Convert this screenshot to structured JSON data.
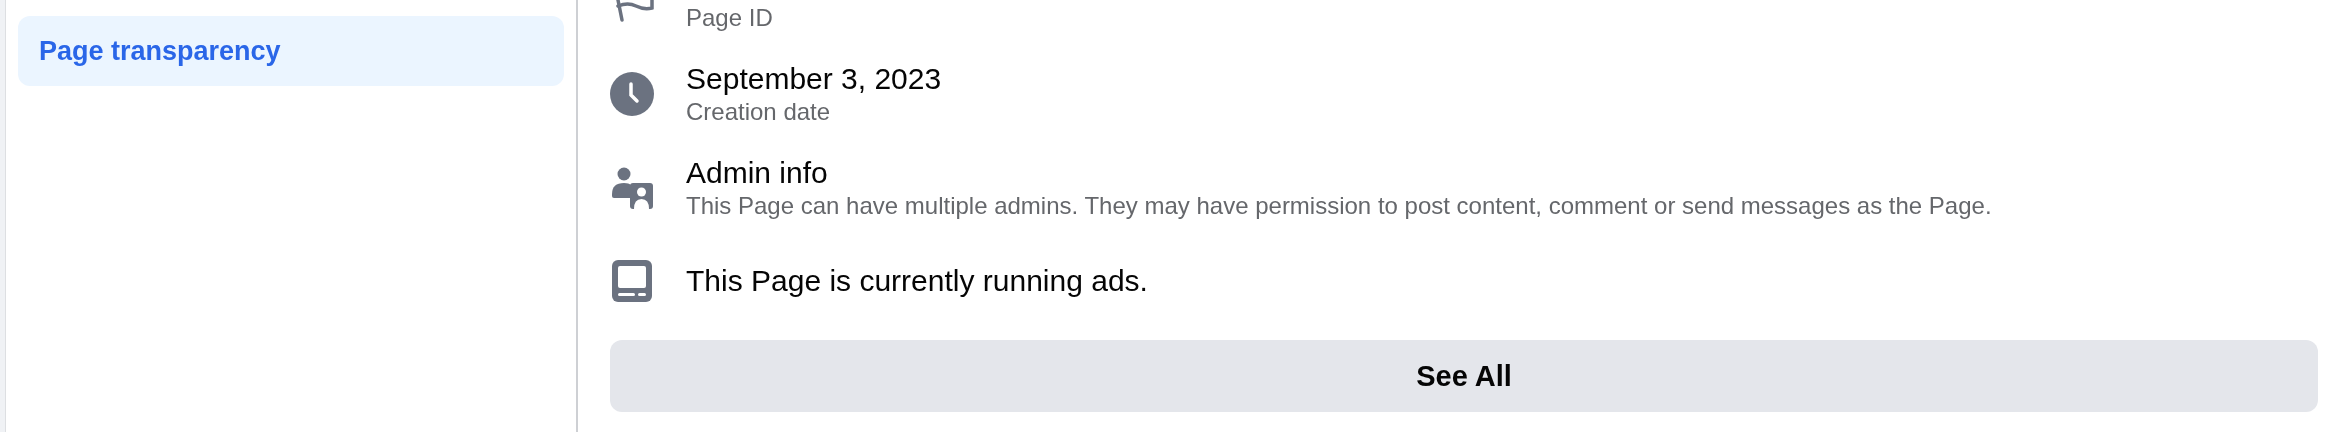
{
  "sidebar": {
    "items": [
      {
        "label": "Page transparency",
        "selected": true
      }
    ]
  },
  "details": [
    {
      "kind": "flag",
      "subtitle": "Page ID"
    },
    {
      "kind": "clock",
      "title": "September 3, 2023",
      "subtitle": "Creation date"
    },
    {
      "kind": "admins",
      "title": "Admin info",
      "subtitle": "This Page can have multiple admins. They may have permission to post content, comment or send messages as the Page."
    },
    {
      "kind": "ads",
      "title": "This Page is currently running ads."
    }
  ],
  "button": {
    "label": "See All"
  }
}
